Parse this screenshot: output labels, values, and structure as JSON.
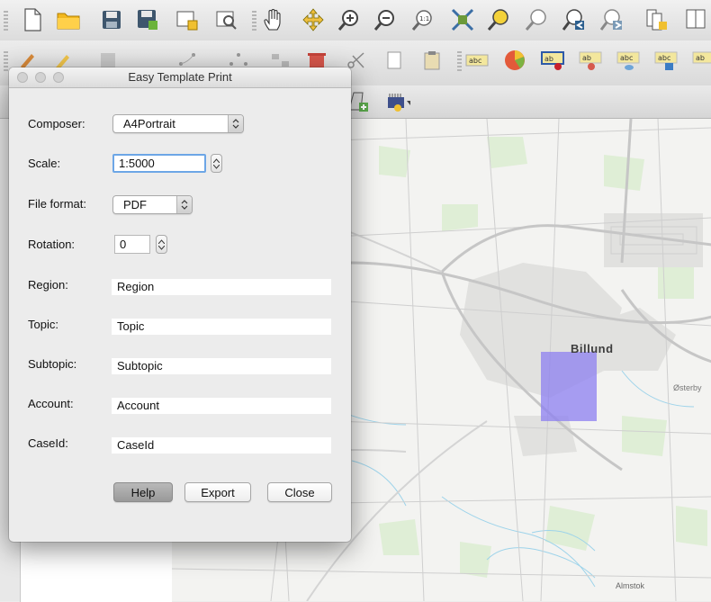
{
  "dialog": {
    "title": "Easy Template Print",
    "fields": {
      "composer_label": "Composer:",
      "composer_value": "A4Portrait",
      "scale_label": "Scale:",
      "scale_value": "1:5000",
      "file_format_label": "File format:",
      "file_format_value": "PDF",
      "rotation_label": "Rotation:",
      "rotation_value": "0",
      "region_label": "Region:",
      "region_value": "Region",
      "topic_label": "Topic:",
      "topic_value": "Topic",
      "subtopic_label": "Subtopic:",
      "subtopic_value": "Subtopic",
      "account_label": "Account:",
      "account_value": "Account",
      "caseid_label": "CaseId:",
      "caseid_value": "CaseId"
    },
    "buttons": {
      "help": "Help",
      "export": "Export",
      "close": "Close"
    }
  },
  "map": {
    "labels": {
      "billund": "Billund",
      "osterby": "Østerby",
      "almstok": "Almstok"
    },
    "selection_color": "#8c7ff0",
    "road_color": "#c6c6c6",
    "water_color": "#9dd3ea",
    "green_color": "#dfeed6"
  },
  "toolbar": {
    "row1_icons": [
      "new-project-icon",
      "open-project-icon",
      "save-icon",
      "save-as-icon",
      "new-composer-icon",
      "composer-manager-icon",
      "pan-icon",
      "pan-to-selection-icon",
      "zoom-in-icon",
      "zoom-out-icon",
      "zoom-native-icon",
      "zoom-full-icon",
      "zoom-to-selection-icon",
      "zoom-to-layer-icon",
      "zoom-last-icon",
      "zoom-next-icon",
      "new-bookmark-icon",
      "show-bookmarks-icon"
    ],
    "row2_icons": [
      "digitize-icon",
      "edit-pencil-icon",
      "save-edits-icon",
      "add-feature-icon",
      "move-feature-icon",
      "node-tool-icon",
      "delete-selected-icon",
      "cut-features-icon",
      "copy-features-icon",
      "paste-features-icon",
      "label-icon",
      "diagram-icon",
      "layer-labeling-icon",
      "pin-labels-icon",
      "show-hide-labels-icon",
      "move-label-icon",
      "rotate-label-icon"
    ]
  }
}
